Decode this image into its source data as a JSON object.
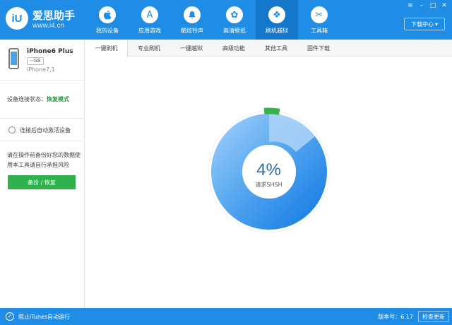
{
  "app": {
    "logo_mark": "iU",
    "name": "爱思助手",
    "url": "www.i4.cn"
  },
  "nav": [
    {
      "label": "我的设备",
      "icon": "apple-icon",
      "glyph": ""
    },
    {
      "label": "应用游戏",
      "icon": "app-store-icon",
      "glyph": "A"
    },
    {
      "label": "酷炫铃声",
      "icon": "bell-icon",
      "glyph": "🔔"
    },
    {
      "label": "高清壁纸",
      "icon": "flower-icon",
      "glyph": "✿"
    },
    {
      "label": "刷机越狱",
      "icon": "dropbox-icon",
      "glyph": "❖"
    },
    {
      "label": "工具箱",
      "icon": "tools-icon",
      "glyph": "✂"
    }
  ],
  "window_controls": {
    "menu": "≡",
    "minimize": "–",
    "maximize": "□",
    "close": "✕"
  },
  "download_center": {
    "label": "下载中心",
    "arrow": "▾"
  },
  "device": {
    "name": "iPhone6 Plus",
    "capacity": "--GB",
    "model": "iPhone7,1"
  },
  "connection": {
    "label": "设备连接状态：",
    "value": "恢复模式"
  },
  "auto_activate": {
    "label": "连接后自动激活设备"
  },
  "tip": "请在操作前备份好您的数据使用本工具请自行承担风险",
  "backup_button": "备份 / 恢复",
  "tabs": [
    {
      "label": "一键刷机",
      "active": true
    },
    {
      "label": "专业刷机",
      "active": false
    },
    {
      "label": "一键越狱",
      "active": false
    },
    {
      "label": "高级功能",
      "active": false
    },
    {
      "label": "其他工具",
      "active": false
    },
    {
      "label": "固件下载",
      "active": false
    }
  ],
  "progress": {
    "percent_text": "4%",
    "value": 0.04,
    "label": "请求SHSH"
  },
  "footer": {
    "check": "✓",
    "itunes_label": "阻止iTunes自动运行",
    "version": "版本号：6.17",
    "update_button": "检查更新"
  },
  "colors": {
    "primary": "#1f8de5",
    "active_nav": "#1577c9",
    "ring_outer": "#2c8ae8",
    "ring_inner": "#5aa9f0",
    "ring_highlight": "#a7d0f7",
    "progress": "#38b34a",
    "status_green": "#2e9e47"
  }
}
